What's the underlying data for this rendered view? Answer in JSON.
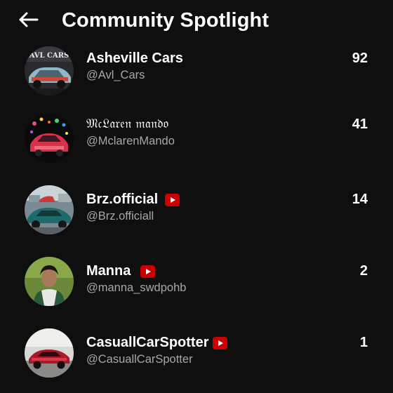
{
  "header": {
    "title": "Community Spotlight",
    "back_icon": "arrow-left-icon"
  },
  "members": [
    {
      "name": "Asheville Cars",
      "handle": "@Avl_Cars",
      "count": "92",
      "verified_channel": false,
      "avatar_text": "AVL CARS"
    },
    {
      "name": "𝔐𝔠𝔏𝔞𝔯𝔢𝔫 𝔪𝔞𝔫𝔡𝔬",
      "handle": "@MclarenMando",
      "count": "41",
      "verified_channel": false
    },
    {
      "name": "Brz.official",
      "handle": "@Brz.officiall",
      "count": "14",
      "verified_channel": true
    },
    {
      "name": "Manna",
      "handle": "@manna_swdpohb",
      "count": "2",
      "verified_channel": true
    },
    {
      "name": "CasuallCarSpotter",
      "handle": "@CasuallCarSpotter",
      "count": "1",
      "verified_channel": true
    }
  ],
  "colors": {
    "background": "#0f0f0f",
    "text_primary": "#ffffff",
    "text_secondary": "#a8a8a8",
    "badge_red": "#cc0000"
  }
}
